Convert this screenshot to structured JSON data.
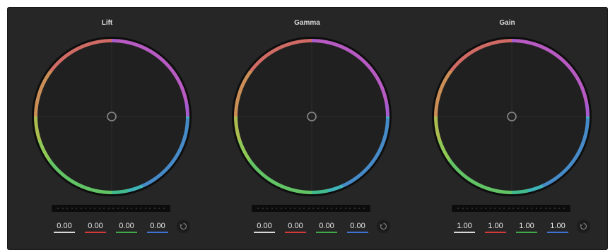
{
  "wheels": [
    {
      "title": "Lift",
      "values": {
        "y": "0.00",
        "r": "0.00",
        "g": "0.00",
        "b": "0.00"
      }
    },
    {
      "title": "Gamma",
      "values": {
        "y": "0.00",
        "r": "0.00",
        "g": "0.00",
        "b": "0.00"
      }
    },
    {
      "title": "Gain",
      "values": {
        "y": "1.00",
        "r": "1.00",
        "g": "1.00",
        "b": "1.00"
      }
    }
  ],
  "colors": {
    "panel": "#262626",
    "channel_y": "#d8d8d8",
    "channel_r": "#d33a3a",
    "channel_g": "#3fa84a",
    "channel_b": "#3f74d6"
  },
  "icons": {
    "reset": "reset-icon",
    "center": "wheel-center-handle"
  }
}
